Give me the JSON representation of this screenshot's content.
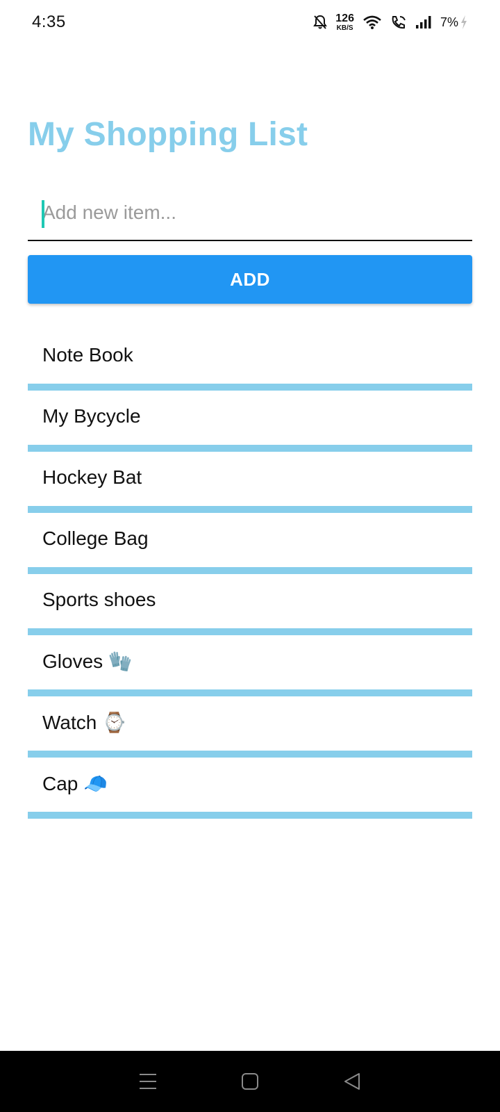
{
  "status_bar": {
    "time": "4:35",
    "net_speed_value": "126",
    "net_speed_unit": "KB/S",
    "battery": "7%"
  },
  "title": "My Shopping List",
  "input": {
    "placeholder": "Add new item...",
    "value": ""
  },
  "add_button_label": "ADD",
  "items": [
    "Note Book",
    "My Bycycle",
    "Hockey Bat",
    "College Bag",
    "Sports shoes",
    "Gloves 🧤",
    "Watch ⌚",
    "Cap 🧢"
  ],
  "colors": {
    "title": "#87ceeb",
    "divider": "#87ceeb",
    "button": "#2196f3",
    "caret": "#1fc8b4"
  },
  "icons": {
    "status": [
      "bell-off-icon",
      "wifi-icon",
      "wifi-call-icon",
      "signal-icon",
      "charging-icon"
    ],
    "nav": [
      "menu-icon",
      "home-icon",
      "back-icon"
    ]
  }
}
